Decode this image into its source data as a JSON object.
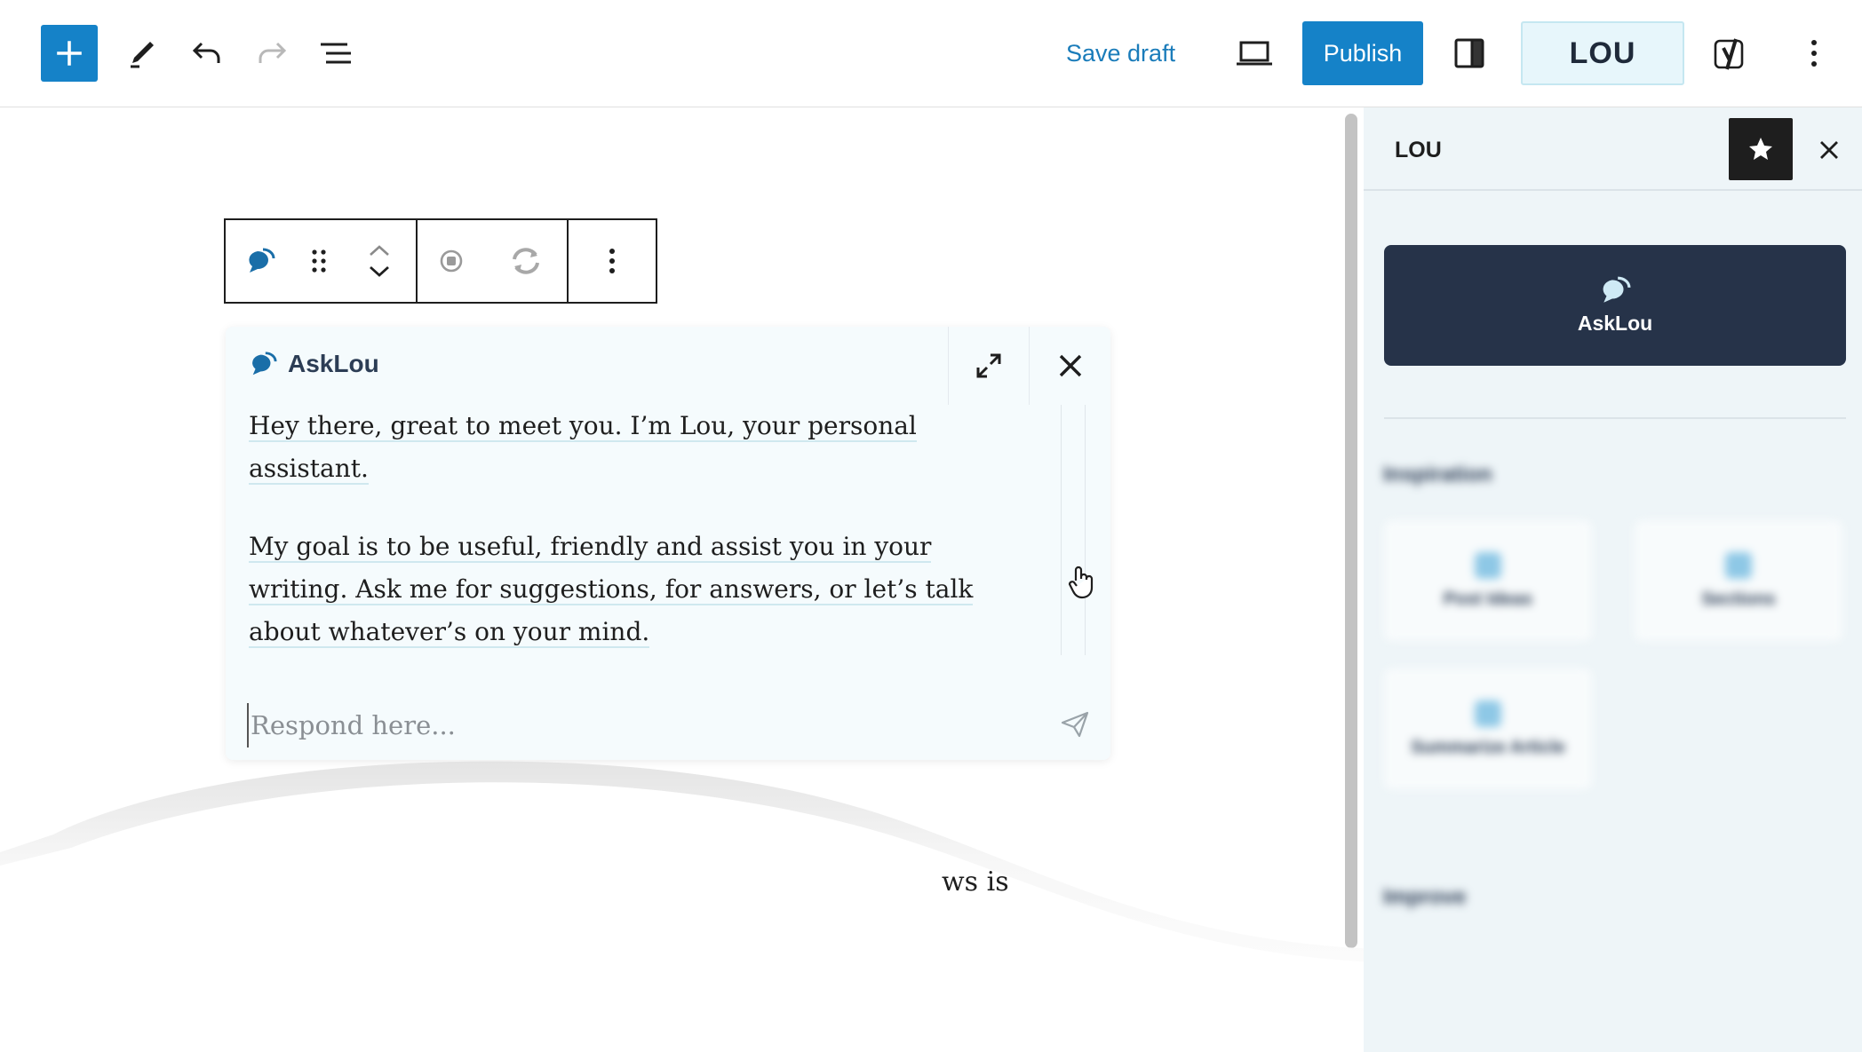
{
  "toolbar": {
    "save_draft_label": "Save draft",
    "publish_label": "Publish",
    "lou_label": "LOU",
    "icons": [
      "plus-icon",
      "pencil-icon",
      "undo-icon",
      "redo-icon",
      "list-view-icon",
      "laptop-preview-icon",
      "sidebar-toggle-icon",
      "yoast-icon",
      "more-vertical-icon"
    ]
  },
  "chat": {
    "title": "AskLou",
    "message_1": "Hey there, great to meet you. I’m Lou, your personal assistant.",
    "message_2": "My goal is to be useful, friendly and assist you in your writing. Ask me for suggestions, for answers, or let’s talk about whatever’s on your mind.",
    "input_placeholder": "Respond here..."
  },
  "editor": {
    "partial_text": "ws is"
  },
  "sidebar": {
    "title": "LOU",
    "asklou_label": "AskLou",
    "sections": {
      "inspiration": "Inspiration",
      "improve": "Improve"
    },
    "tiles": [
      {
        "label": "Post Ideas"
      },
      {
        "label": "Sections"
      },
      {
        "label": "Summarize Article"
      }
    ]
  },
  "colors": {
    "accent": "#1582c8",
    "card_dark": "#263349",
    "sidebar_bg": "#eef5f8",
    "chat_bg": "#f5fbfd"
  }
}
